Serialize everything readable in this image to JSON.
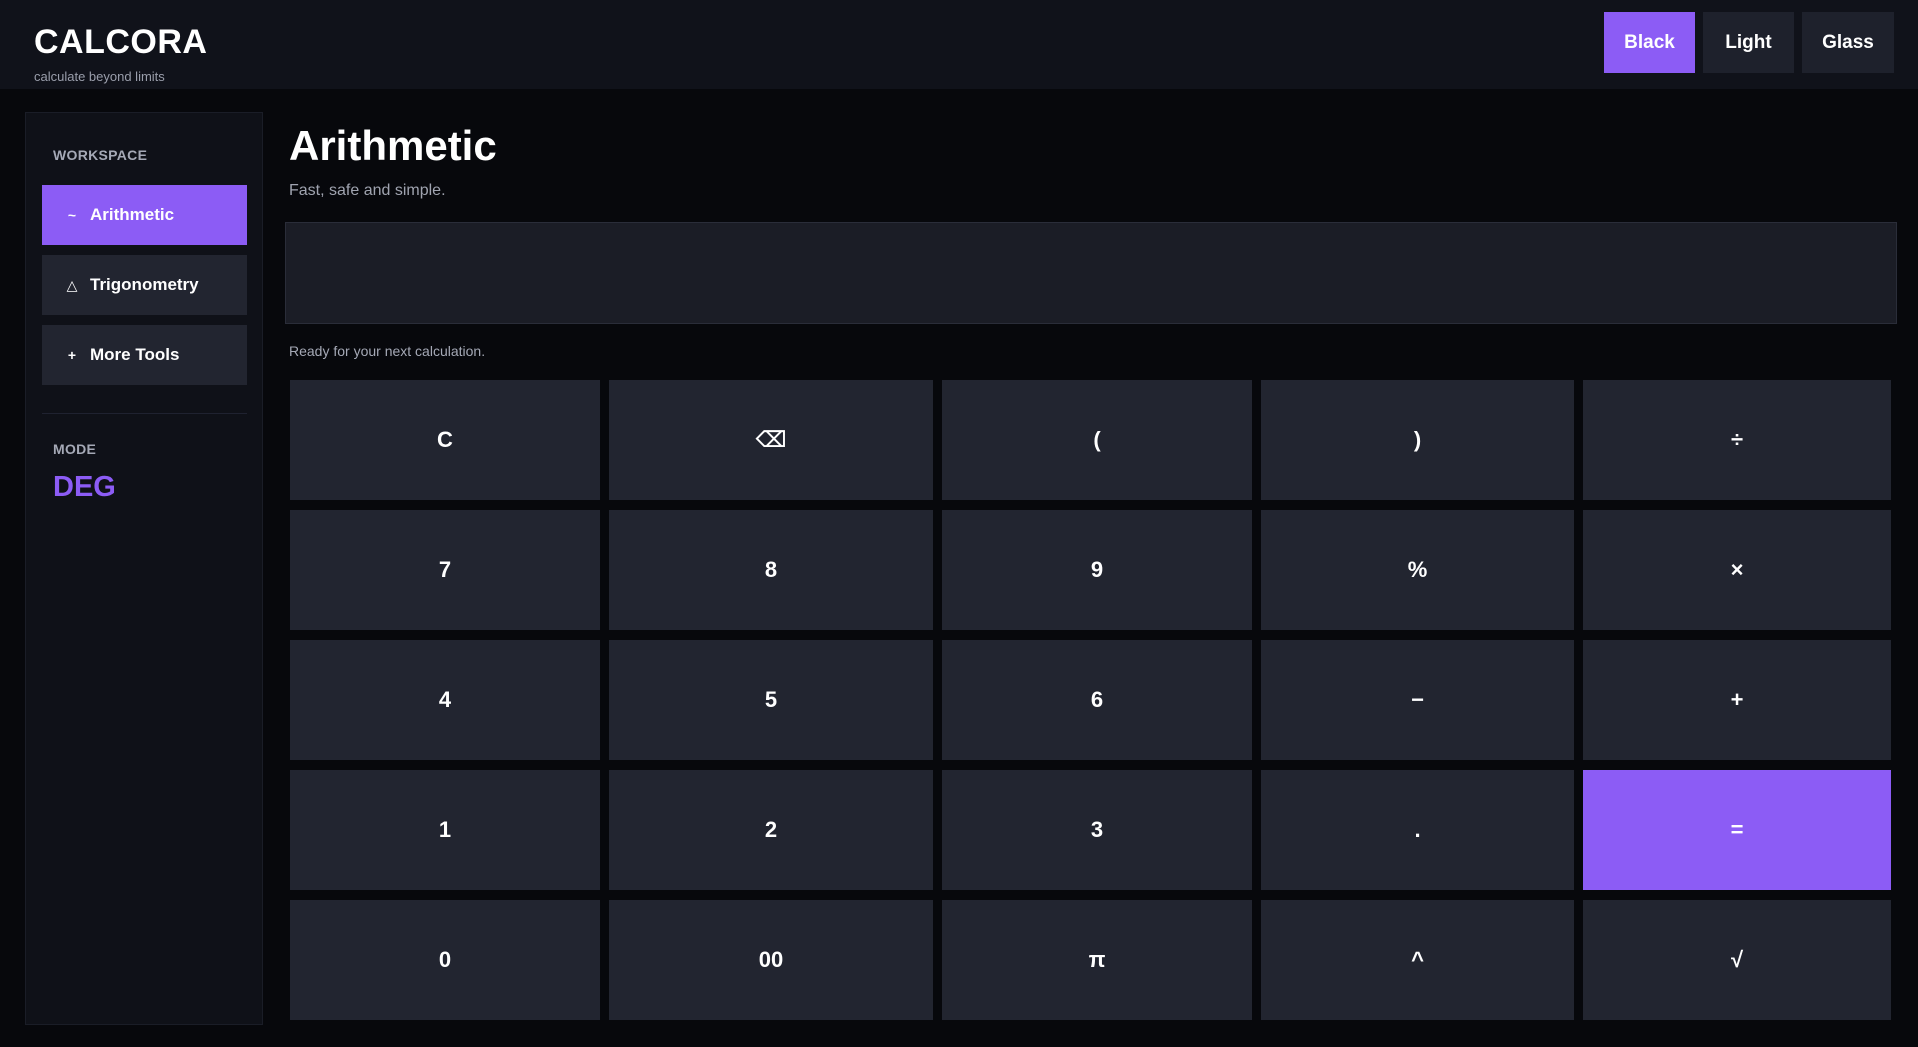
{
  "brand": {
    "title": "CALCORA",
    "tagline": "calculate beyond limits"
  },
  "themes": {
    "black": "Black",
    "light": "Light",
    "glass": "Glass",
    "active": "Black"
  },
  "sidebar": {
    "workspace_label": "WORKSPACE",
    "items": [
      {
        "icon": "~",
        "icon_name": "wave-icon",
        "label": "Arithmetic",
        "active": true
      },
      {
        "icon": "△",
        "icon_name": "triangle-icon",
        "label": "Trigonometry",
        "active": false
      },
      {
        "icon": "+",
        "icon_name": "plus-icon",
        "label": "More Tools",
        "active": false
      }
    ],
    "mode_label": "MODE",
    "mode_value": "DEG"
  },
  "main": {
    "title": "Arithmetic",
    "subtitle": "Fast, safe and simple.",
    "display_value": "",
    "status": "Ready for your next calculation."
  },
  "keypad": {
    "rows": [
      [
        "C",
        "⌫",
        "(",
        ")",
        "÷"
      ],
      [
        "7",
        "8",
        "9",
        "%",
        "×"
      ],
      [
        "4",
        "5",
        "6",
        "−",
        "+"
      ],
      [
        "1",
        "2",
        "3",
        ".",
        "="
      ],
      [
        "0",
        "00",
        "π",
        "^",
        "√"
      ]
    ],
    "accent_key": "="
  },
  "colors": {
    "accent": "#8c5cf5",
    "background": "#07080c",
    "surface": "#222530",
    "topbar": "#10121a"
  }
}
